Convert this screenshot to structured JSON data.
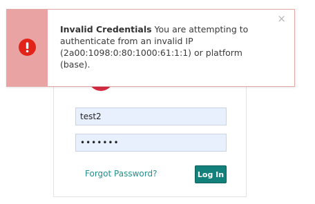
{
  "alert": {
    "title": "Invalid Credentials",
    "message": "You are attempting to authenticate from an invalid IP (2a00:1098:0:80:1000:61:1:1) or platform (base).",
    "close_symbol": "×",
    "icon": "exclamation-circle-icon",
    "icon_color": "#e2231a",
    "stripe_color": "#eaa3a3"
  },
  "login": {
    "username_value": "test2",
    "password_value": "•••••••",
    "forgot_label": "Forgot Password?",
    "login_label": "Log In",
    "accent_color": "#14807b"
  }
}
